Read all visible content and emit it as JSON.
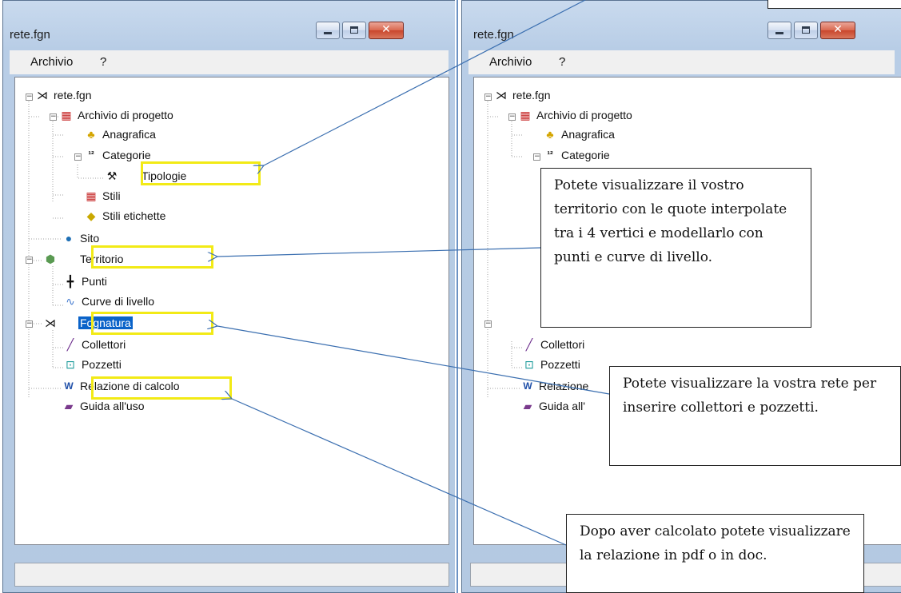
{
  "left_window": {
    "title": "rete.fgn",
    "menu": [
      "Archivio",
      "?"
    ],
    "window_buttons": [
      "minimize",
      "maximize",
      "close"
    ],
    "tree": [
      {
        "label": "rete.fgn",
        "icon": "network-icon"
      },
      {
        "label": "Archivio di progetto",
        "icon": "project-archive-icon"
      },
      {
        "label": "Anagrafica",
        "icon": "people-icon"
      },
      {
        "label": "Categorie",
        "icon": "categories-icon"
      },
      {
        "label": "Tipologie",
        "icon": "tools-icon"
      },
      {
        "label": "Stili",
        "icon": "styles-icon"
      },
      {
        "label": "Stili etichette",
        "icon": "label-styles-icon"
      },
      {
        "label": "Sito",
        "icon": "globe-icon"
      },
      {
        "label": "Territorio",
        "icon": "terrain-icon"
      },
      {
        "label": "Punti",
        "icon": "point-icon"
      },
      {
        "label": "Curve di livello",
        "icon": "contour-icon"
      },
      {
        "label": "Fognatura",
        "icon": "network-icon",
        "selected": true
      },
      {
        "label": "Collettori",
        "icon": "pipe-icon"
      },
      {
        "label": "Pozzetti",
        "icon": "manhole-icon"
      },
      {
        "label": "Relazione di calcolo",
        "icon": "word-doc-icon"
      },
      {
        "label": "Guida all'uso",
        "icon": "book-icon"
      }
    ]
  },
  "right_window": {
    "title": "rete.fgn",
    "menu": [
      "Archivio",
      "?"
    ],
    "window_buttons": [
      "minimize",
      "maximize",
      "close"
    ],
    "tree": [
      {
        "label": "rete.fgn",
        "icon": "network-icon"
      },
      {
        "label": "Archivio di progetto",
        "icon": "project-archive-icon"
      },
      {
        "label": "Anagrafica",
        "icon": "people-icon"
      },
      {
        "label": "Categorie",
        "icon": "categories-icon"
      },
      {
        "label": "Collettori",
        "icon": "pipe-icon"
      },
      {
        "label": "Pozzetti",
        "icon": "manhole-icon"
      },
      {
        "label": "Relazione",
        "icon": "word-doc-icon"
      },
      {
        "label": "Guida all'",
        "icon": "book-icon"
      }
    ]
  },
  "callouts": {
    "territorio": "Potete visualizzare il vostro territorio con le quote interpolate tra i 4 vertici e modellarlo con punti e curve di livello.",
    "fognatura": "Potete visualizzare la vostra rete per inserire collettori e pozzetti.",
    "relazione": "Dopo aver calcolato potete visualizzare la relazione in pdf o in doc."
  },
  "colors": {
    "highlight_box": "#f2ea16",
    "arrow": "#3b6fb0",
    "selection": "#0a63c9",
    "window_frame": "#b8cde6"
  }
}
